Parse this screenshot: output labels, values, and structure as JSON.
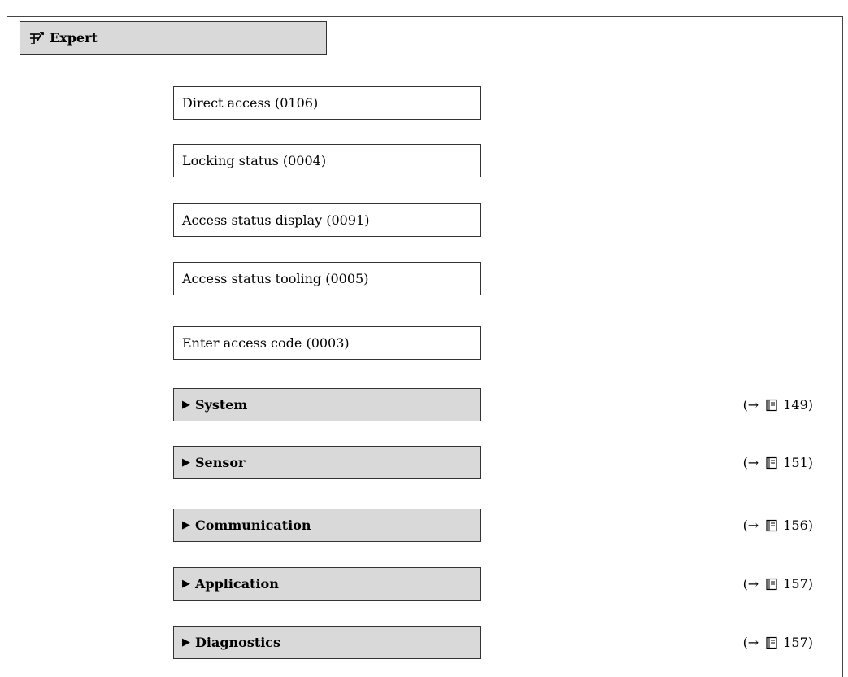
{
  "header": {
    "title": "Expert",
    "icon": "expert-wrench-icon"
  },
  "parameters": [
    {
      "label": "Direct access (0106)"
    },
    {
      "label": "Locking status (0004)"
    },
    {
      "label": "Access status display (0091)"
    },
    {
      "label": "Access status tooling (0005)"
    },
    {
      "label": "Enter access code (0003)"
    }
  ],
  "submenus": [
    {
      "label": "System",
      "ref_prefix": "(→",
      "ref_page": "149)"
    },
    {
      "label": "Sensor",
      "ref_prefix": "(→",
      "ref_page": "151)"
    },
    {
      "label": "Communication",
      "ref_prefix": "(→",
      "ref_page": "156)"
    },
    {
      "label": "Application",
      "ref_prefix": "(→",
      "ref_page": "157)"
    },
    {
      "label": "Diagnostics",
      "ref_prefix": "(→",
      "ref_page": "157)"
    }
  ],
  "glyphs": {
    "submenu_arrow": "▶"
  }
}
